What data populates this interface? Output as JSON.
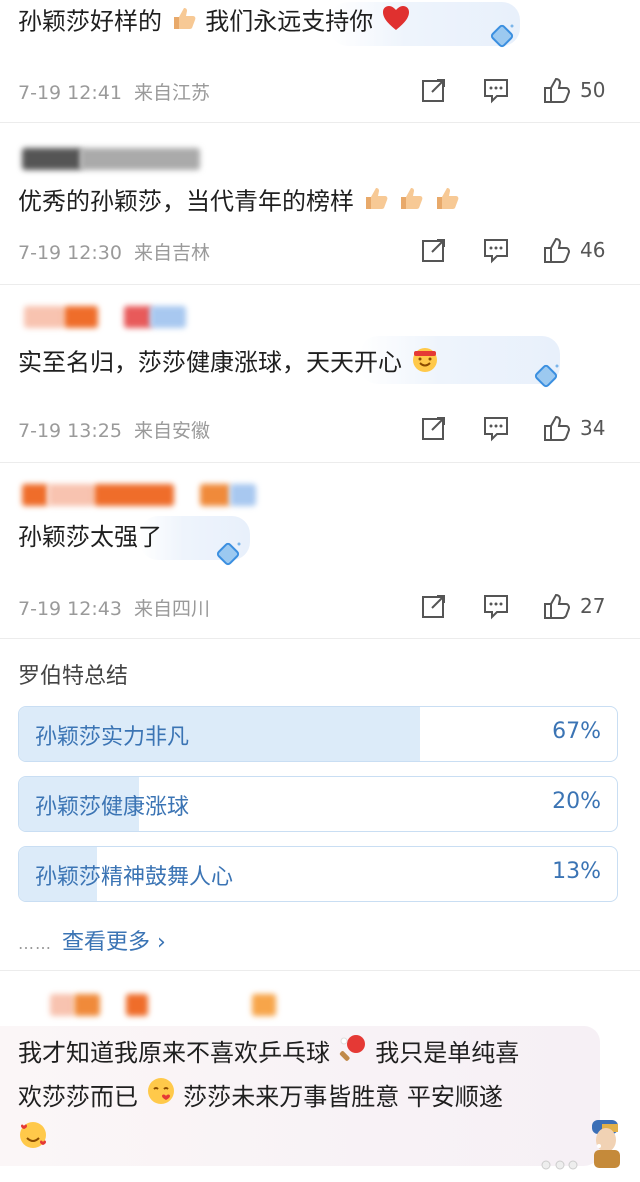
{
  "comments": [
    {
      "text_a": "孙颖莎好样的",
      "text_b": "我们永远支持你",
      "time": "7-19 12:41",
      "location": "来自江苏",
      "likes": "50"
    },
    {
      "text": "优秀的孙颖莎，当代青年的榜样",
      "time": "7-19 12:30",
      "location": "来自吉林",
      "likes": "46"
    },
    {
      "text": "实至名归，莎莎健康涨球，天天开心",
      "time": "7-19 13:25",
      "location": "来自安徽",
      "likes": "34"
    },
    {
      "text": "孙颖莎太强了",
      "time": "7-19 12:43",
      "location": "来自四川",
      "likes": "27"
    }
  ],
  "poll": {
    "title": "罗伯特总结",
    "options": [
      {
        "label": "孙颖莎实力非凡",
        "percent": "67%",
        "value": 0.67
      },
      {
        "label": "孙颖莎健康涨球",
        "percent": "20%",
        "value": 0.2
      },
      {
        "label": "孙颖莎精神鼓舞人心",
        "percent": "13%",
        "value": 0.13
      }
    ],
    "more_dots": "……",
    "more_label": "查看更多 ›"
  },
  "last_comment": {
    "line1_a": "我才知道我原来不喜欢乒乓球",
    "line1_b": "我只是单纯喜",
    "line2_a": "欢莎莎而已",
    "line2_b": "莎莎未来万事皆胜意 平安顺遂"
  },
  "icons": {
    "share": "share-icon",
    "comment": "comment-icon",
    "like": "thumbs-up-icon",
    "gem": "blue-gem-sticker-icon"
  },
  "colors": {
    "poll_accent": "#3b74b4",
    "poll_fill": "#dcebf9",
    "meta_gray": "#9a9a9a"
  }
}
